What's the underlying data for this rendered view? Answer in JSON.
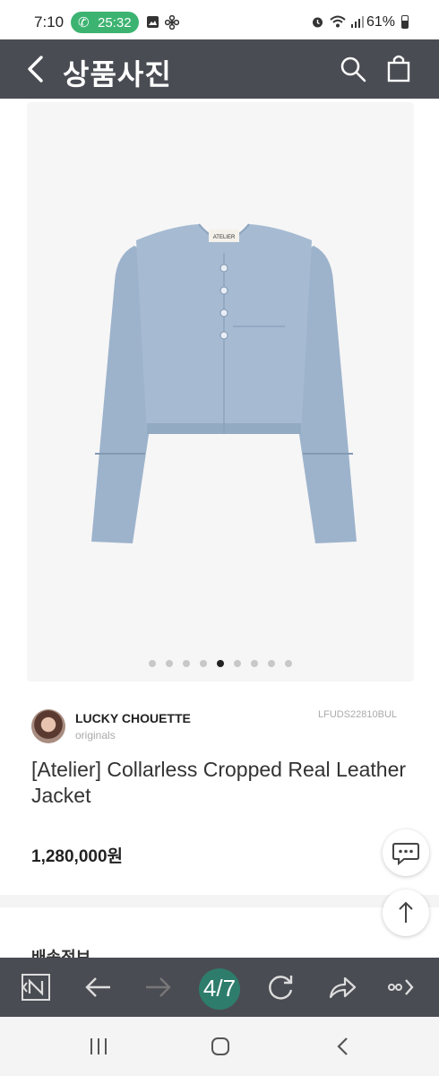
{
  "status_bar": {
    "time": "7:10",
    "call_timer": "25:32",
    "battery_percent": "61%",
    "battery_level": 0.61,
    "icons": [
      "phone-icon",
      "gallery-icon",
      "pinwheel-icon",
      "alarm-icon",
      "wifi-icon",
      "signal-icon",
      "battery-icon"
    ]
  },
  "header": {
    "title": "상품사진",
    "icons": [
      "back-icon",
      "search-icon",
      "shopping-bag-icon"
    ]
  },
  "gallery": {
    "dot_count": 9,
    "active_index": 4
  },
  "product": {
    "brand": "LUCKY CHOUETTE",
    "brand_subtitle": "originals",
    "code": "LFUDS22810BUL",
    "name": "[Atelier] Collarless Cropped Real Leather Jacket",
    "price": "1,280,000원",
    "jacket_label": "ATELIER",
    "jacket_color": "#9db3cc"
  },
  "next_section": {
    "title": "배송정보"
  },
  "floating_buttons": [
    "chat-icon",
    "arrow-up-icon"
  ],
  "browser_toolbar": {
    "page_counter": "4/7",
    "icons": [
      "n-app-icon",
      "back-arrow-icon",
      "forward-arrow-icon",
      "refresh-icon",
      "share-icon",
      "more-icon"
    ]
  },
  "system_nav": {
    "icons": [
      "recents-icon",
      "home-icon",
      "back-icon"
    ]
  },
  "colors": {
    "header_bg": "#4a4c53",
    "call_pill": "#3cb371",
    "page_counter_bg": "#2e7d6c"
  }
}
